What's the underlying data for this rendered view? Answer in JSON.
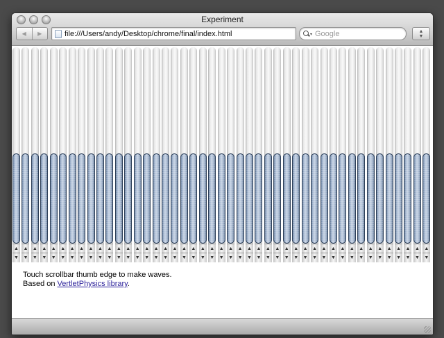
{
  "window": {
    "title": "Experiment"
  },
  "toolbar": {
    "back_icon": "back-arrow-icon",
    "forward_icon": "forward-arrow-icon",
    "back_glyph": "◀",
    "forward_glyph": "▶",
    "address": "file:///Users/andy/Desktop/chrome/final/index.html",
    "search_placeholder": "Google",
    "bookmark_icon": "bookmark-arrows-icon"
  },
  "page": {
    "line1": "Touch scrollbar thumb edge to make waves.",
    "line2_prefix": "Based on ",
    "link_text": "VertletPhysics library",
    "line2_suffix": "."
  },
  "scrollbars": {
    "count": 45,
    "thumb_start_fraction": 0.54,
    "thumb_end_fraction": 1.0,
    "up_glyph": "▲",
    "down_glyph": "▼",
    "thumb_color": "#8ea3c0"
  }
}
